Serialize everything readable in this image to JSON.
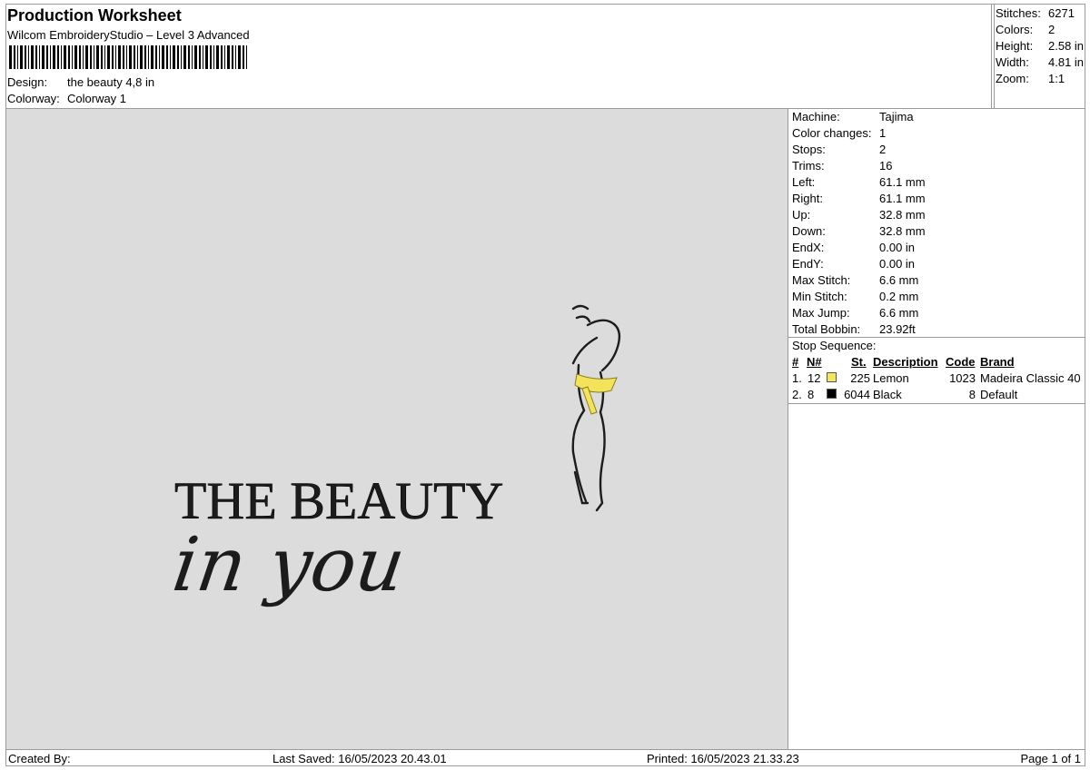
{
  "header": {
    "title": "Production Worksheet",
    "subtitle": "Wilcom EmbroideryStudio – Level 3 Advanced",
    "design_label": "Design:",
    "design_value": "the beauty 4,8 in",
    "colorway_label": "Colorway:",
    "colorway_value": "Colorway 1"
  },
  "summary": [
    {
      "label": "Stitches:",
      "value": "6271"
    },
    {
      "label": "Colors:",
      "value": "2"
    },
    {
      "label": "Height:",
      "value": "2.58 in"
    },
    {
      "label": "Width:",
      "value": "4.81 in"
    },
    {
      "label": "Zoom:",
      "value": "1:1"
    }
  ],
  "design_preview": {
    "line1": "THE BEAUTY",
    "line2": "in you",
    "thread_main": "#1c1c1c",
    "thread_accent": "#f2e35a"
  },
  "stats": [
    {
      "label": "Machine:",
      "value": "Tajima"
    },
    {
      "label": "Color changes:",
      "value": "1"
    },
    {
      "label": "Stops:",
      "value": "2"
    },
    {
      "label": "Trims:",
      "value": "16"
    },
    {
      "label": "Left:",
      "value": "61.1 mm"
    },
    {
      "label": "Right:",
      "value": "61.1 mm"
    },
    {
      "label": "Up:",
      "value": "32.8 mm"
    },
    {
      "label": "Down:",
      "value": "32.8 mm"
    },
    {
      "label": "EndX:",
      "value": "0.00 in"
    },
    {
      "label": "EndY:",
      "value": "0.00 in"
    },
    {
      "label": "Max Stitch:",
      "value": "6.6 mm"
    },
    {
      "label": "Min Stitch:",
      "value": "0.2 mm"
    },
    {
      "label": "Max Jump:",
      "value": "6.6 mm"
    },
    {
      "label": "Total Bobbin:",
      "value": "23.92ft"
    }
  ],
  "stop_sequence": {
    "title": "Stop Sequence:",
    "columns": [
      "#",
      "N#",
      "St.",
      "Description",
      "Code",
      "Brand"
    ],
    "rows": [
      {
        "index": "1.",
        "needle": "12",
        "color": "#f5e65e",
        "stitches": "225",
        "description": "Lemon",
        "code": "1023",
        "brand": "Madeira Classic 40"
      },
      {
        "index": "2.",
        "needle": "8",
        "color": "#000000",
        "stitches": "6044",
        "description": "Black",
        "code": "8",
        "brand": "Default"
      }
    ]
  },
  "footer": {
    "created_by": "Created By:",
    "last_saved": "Last Saved: 16/05/2023 20.43.01",
    "printed": "Printed: 16/05/2023 21.33.23",
    "page": "Page 1 of 1"
  }
}
